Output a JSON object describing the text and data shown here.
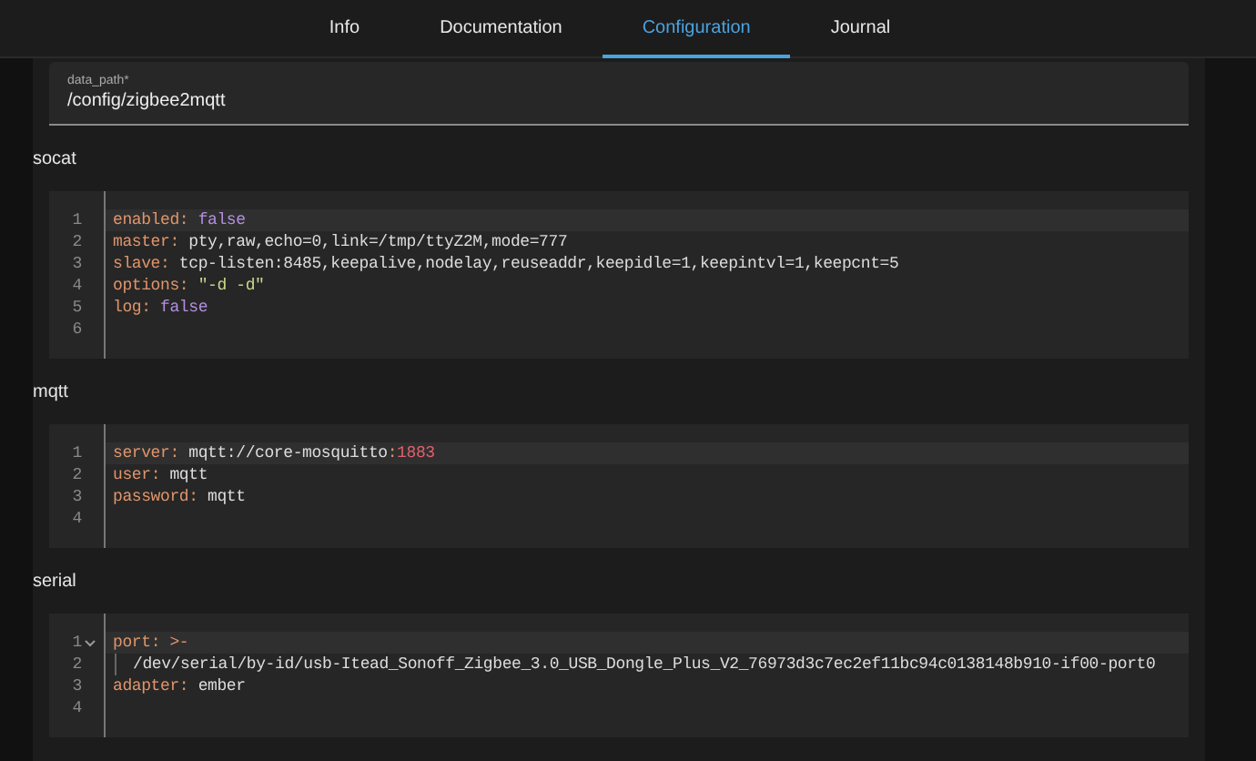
{
  "tabs": [
    {
      "label": "Info",
      "selected": false
    },
    {
      "label": "Documentation",
      "selected": false
    },
    {
      "label": "Configuration",
      "selected": true
    },
    {
      "label": "Journal",
      "selected": false
    }
  ],
  "data_path_field": {
    "label": "data_path*",
    "value": "/config/zigbee2mqtt"
  },
  "sections": [
    {
      "title": "socat",
      "lines": [
        {
          "number": "1",
          "active": true,
          "fold": false,
          "tokens": [
            {
              "kind": "key",
              "text": "enabled"
            },
            {
              "kind": "punct",
              "text": ": "
            },
            {
              "kind": "bool",
              "text": "false"
            }
          ]
        },
        {
          "number": "2",
          "active": false,
          "fold": false,
          "tokens": [
            {
              "kind": "key",
              "text": "master"
            },
            {
              "kind": "punct",
              "text": ": "
            },
            {
              "kind": "plain",
              "text": "pty,raw,echo=0,link=/tmp/ttyZ2M,mode=777"
            }
          ]
        },
        {
          "number": "3",
          "active": false,
          "fold": false,
          "tokens": [
            {
              "kind": "key",
              "text": "slave"
            },
            {
              "kind": "punct",
              "text": ": "
            },
            {
              "kind": "plain",
              "text": "tcp-listen:8485,keepalive,nodelay,reuseaddr,keepidle=1,keepintvl=1,keepcnt=5"
            }
          ]
        },
        {
          "number": "4",
          "active": false,
          "fold": false,
          "tokens": [
            {
              "kind": "key",
              "text": "options"
            },
            {
              "kind": "punct",
              "text": ": "
            },
            {
              "kind": "string",
              "text": "\"-d -d\""
            }
          ]
        },
        {
          "number": "5",
          "active": false,
          "fold": false,
          "tokens": [
            {
              "kind": "key",
              "text": "log"
            },
            {
              "kind": "punct",
              "text": ": "
            },
            {
              "kind": "bool",
              "text": "false"
            }
          ]
        },
        {
          "number": "6",
          "active": false,
          "fold": false
        }
      ]
    },
    {
      "title": "mqtt",
      "lines": [
        {
          "number": "1",
          "active": true,
          "fold": false,
          "tokens": [
            {
              "kind": "key",
              "text": "server"
            },
            {
              "kind": "punct",
              "text": ": "
            },
            {
              "kind": "plain",
              "text": "mqtt://core-mosquitto"
            },
            {
              "kind": "punct",
              "text": ":"
            },
            {
              "kind": "number",
              "text": "1883"
            }
          ]
        },
        {
          "number": "2",
          "active": false,
          "fold": false,
          "tokens": [
            {
              "kind": "key",
              "text": "user"
            },
            {
              "kind": "punct",
              "text": ": "
            },
            {
              "kind": "plain",
              "text": "mqtt"
            }
          ]
        },
        {
          "number": "3",
          "active": false,
          "fold": false,
          "tokens": [
            {
              "kind": "key",
              "text": "password"
            },
            {
              "kind": "punct",
              "text": ": "
            },
            {
              "kind": "plain",
              "text": "mqtt"
            }
          ]
        },
        {
          "number": "4",
          "active": false,
          "fold": false
        }
      ]
    },
    {
      "title": "serial",
      "lines": [
        {
          "number": "1",
          "active": true,
          "fold": true,
          "tokens": [
            {
              "kind": "key",
              "text": "port"
            },
            {
              "kind": "punct",
              "text": ": "
            },
            {
              "kind": "punct",
              "text": ">-"
            }
          ]
        },
        {
          "number": "2",
          "active": false,
          "fold": false,
          "indent_guide": true,
          "tokens": [
            {
              "kind": "plain",
              "text": "/dev/serial/by-id/usb-Itead_Sonoff_Zigbee_3.0_USB_Dongle_Plus_V2_76973d3c7ec2ef11bc94c0138148b910-if00-port0"
            }
          ]
        },
        {
          "number": "3",
          "active": false,
          "fold": false,
          "tokens": [
            {
              "kind": "key",
              "text": "adapter"
            },
            {
              "kind": "punct",
              "text": ": "
            },
            {
              "kind": "plain",
              "text": "ember"
            }
          ]
        },
        {
          "number": "4",
          "active": false,
          "fold": false
        }
      ]
    }
  ]
}
